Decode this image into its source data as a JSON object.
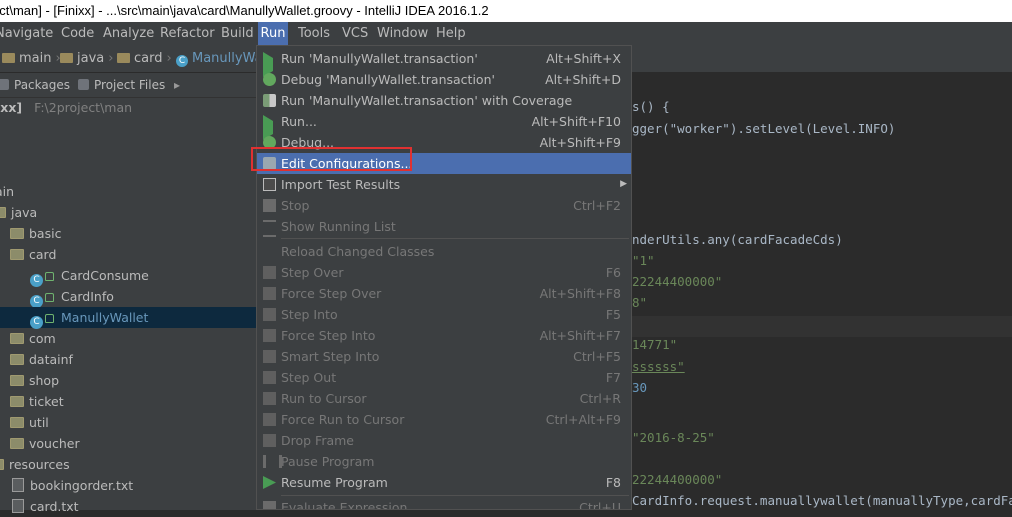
{
  "window": {
    "title": "ect\\man] - [Finixx] - ...\\src\\main\\java\\card\\ManullyWallet.groovy - IntelliJ IDEA 2016.1.2"
  },
  "menubar": {
    "items": [
      "Navigate",
      "Code",
      "Analyze",
      "Refactor",
      "Build",
      "Run",
      "Tools",
      "VCS",
      "Window",
      "Help"
    ],
    "active": "Run"
  },
  "breadcrumbs": [
    "main",
    "java",
    "card",
    "ManullyWa"
  ],
  "project_panel": {
    "tabs": [
      "Packages",
      "Project Files"
    ],
    "root": {
      "name": "ixx]",
      "path": "F:\\2project\\man"
    },
    "tree": [
      {
        "label": "ain",
        "kind": "folder"
      },
      {
        "label": "java",
        "kind": "folder"
      },
      {
        "label": "basic",
        "kind": "folder"
      },
      {
        "label": "card",
        "kind": "folder"
      },
      {
        "label": "CardConsume",
        "kind": "groovy"
      },
      {
        "label": "CardInfo",
        "kind": "groovy"
      },
      {
        "label": "ManullyWallet",
        "kind": "groovy",
        "selected": true
      },
      {
        "label": "com",
        "kind": "folder"
      },
      {
        "label": "datainf",
        "kind": "folder"
      },
      {
        "label": "shop",
        "kind": "folder"
      },
      {
        "label": "ticket",
        "kind": "folder"
      },
      {
        "label": "util",
        "kind": "folder"
      },
      {
        "label": "voucher",
        "kind": "folder"
      },
      {
        "label": "resources",
        "kind": "folder"
      },
      {
        "label": "bookingorder.txt",
        "kind": "file"
      },
      {
        "label": "card.txt",
        "kind": "file"
      }
    ]
  },
  "editor": {
    "lines": [
      "s() {",
      "gger(\"worker\").setLevel(Level.INFO)",
      "nderUtils.any(cardFacadeCds)",
      "\"1\"",
      "22244400000\"",
      "8\"",
      "14771\"",
      "ssssss\"",
      "30",
      "\"2016-8-25\"",
      "22244400000\"",
      "CardInfo.request.manuallywallet(manuallyType,cardFacade"
    ]
  },
  "run_menu": {
    "items": [
      {
        "label": "Run 'ManullyWallet.transaction'",
        "shortcut": "Alt+Shift+X",
        "icon": "run-icon"
      },
      {
        "label": "Debug 'ManullyWallet.transaction'",
        "shortcut": "Alt+Shift+D",
        "icon": "debug-icon"
      },
      {
        "label": "Run 'ManullyWallet.transaction' with Coverage",
        "shortcut": "",
        "icon": "coverage-icon"
      },
      {
        "label": "Run...",
        "shortcut": "Alt+Shift+F10",
        "icon": "run-icon"
      },
      {
        "label": "Debug...",
        "shortcut": "Alt+Shift+F9",
        "icon": "debug-icon"
      },
      {
        "label": "Edit Configurations...",
        "shortcut": "",
        "icon": "edit-configurations-icon",
        "highlighted": true
      },
      {
        "label": "Import Test Results",
        "shortcut": "",
        "icon": "import-icon",
        "submenu": true
      },
      {
        "label": "Stop",
        "shortcut": "Ctrl+F2",
        "icon": "stop-icon",
        "disabled": true
      },
      {
        "label": "Show Running List",
        "shortcut": "",
        "icon": "list-icon",
        "disabled": true
      },
      {
        "label": "Reload Changed Classes",
        "shortcut": "",
        "icon": "",
        "disabled": true
      },
      {
        "label": "Step Over",
        "shortcut": "F6",
        "icon": "step-icon",
        "disabled": true
      },
      {
        "label": "Force Step Over",
        "shortcut": "Alt+Shift+F8",
        "icon": "step-icon",
        "disabled": true
      },
      {
        "label": "Step Into",
        "shortcut": "F5",
        "icon": "step-icon",
        "disabled": true
      },
      {
        "label": "Force Step Into",
        "shortcut": "Alt+Shift+F7",
        "icon": "step-icon",
        "disabled": true
      },
      {
        "label": "Smart Step Into",
        "shortcut": "Ctrl+F5",
        "icon": "step-icon",
        "disabled": true
      },
      {
        "label": "Step Out",
        "shortcut": "F7",
        "icon": "step-icon",
        "disabled": true
      },
      {
        "label": "Run to Cursor",
        "shortcut": "Ctrl+R",
        "icon": "step-icon",
        "disabled": true
      },
      {
        "label": "Force Run to Cursor",
        "shortcut": "Ctrl+Alt+F9",
        "icon": "step-icon",
        "disabled": true
      },
      {
        "label": "Drop Frame",
        "shortcut": "",
        "icon": "step-icon",
        "disabled": true
      },
      {
        "label": "Pause Program",
        "shortcut": "",
        "icon": "pause-icon",
        "disabled": true
      },
      {
        "label": "Resume Program",
        "shortcut": "F8",
        "icon": "resume-icon"
      },
      {
        "label": "Evaluate Expression...",
        "shortcut": "Ctrl+U",
        "icon": "evaluate-icon",
        "disabled": true
      }
    ]
  },
  "colors": {
    "menu_highlight": "#4b6eaf",
    "callout_border": "#e03131",
    "selection": "#0d293e"
  }
}
